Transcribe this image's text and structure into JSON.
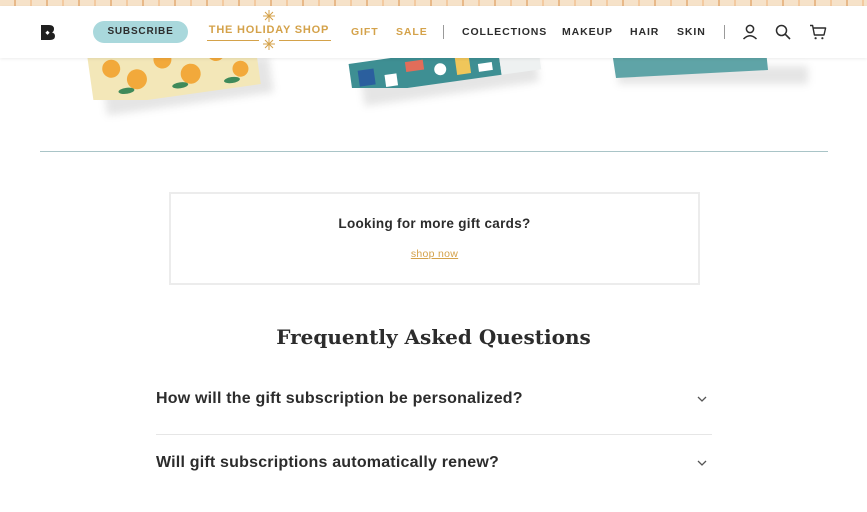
{
  "header": {
    "logo_icon": "brand-logo-icon",
    "subscribe_label": "SUBSCRIBE",
    "holiday_label": "THE HOLIDAY SHOP",
    "nav": {
      "gift": "GIFT",
      "sale": "SALE",
      "collections": "COLLECTIONS",
      "makeup": "MAKEUP",
      "hair": "HAIR",
      "skin": "SKIN"
    },
    "icons": [
      "account-icon",
      "search-icon",
      "cart-icon"
    ],
    "accent_color": "#d4a24a",
    "subscribe_color": "#a9d8dc"
  },
  "gift_cards": {
    "items": [
      "citrus-pattern-card",
      "holiday-pattern-card",
      "teal-card"
    ]
  },
  "more_cards": {
    "title": "Looking for more gift cards?",
    "link": "shop now"
  },
  "faq": {
    "title": "Frequently Asked Questions",
    "items": [
      {
        "question": "How will the gift subscription be personalized?"
      },
      {
        "question": "Will gift subscriptions automatically renew?"
      }
    ]
  }
}
